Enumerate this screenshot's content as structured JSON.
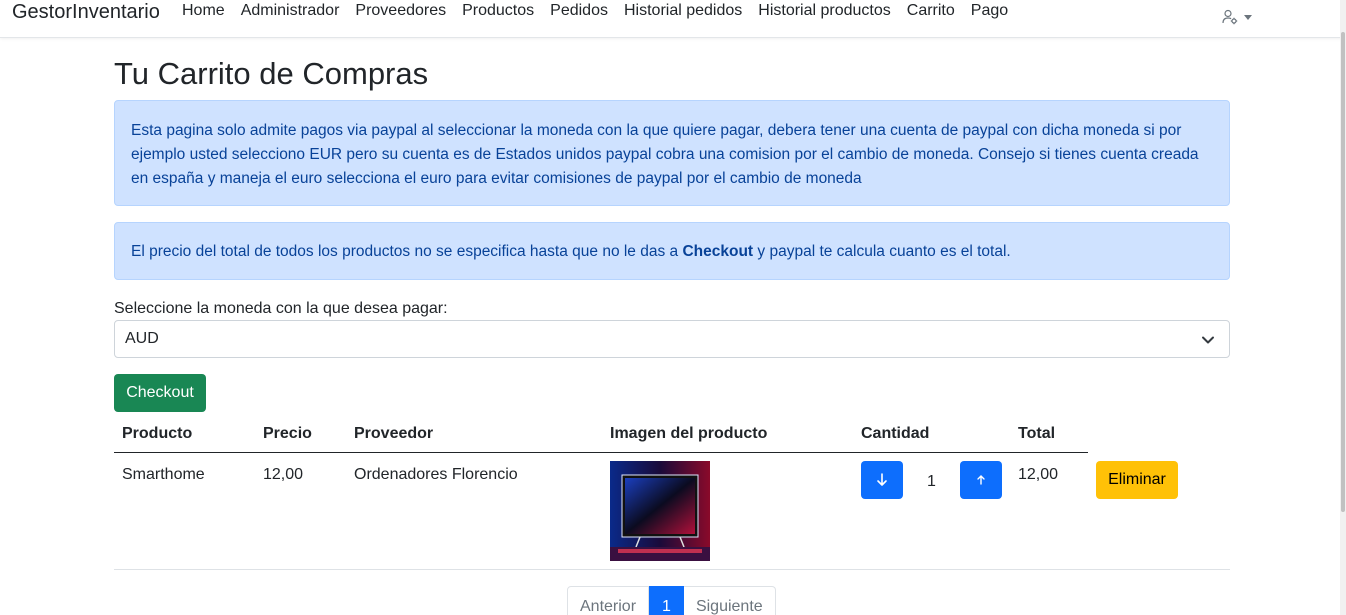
{
  "navbar": {
    "brand": "GestorInventario",
    "links": [
      "Home",
      "Administrador",
      "Proveedores",
      "Productos",
      "Pedidos",
      "Historial pedidos",
      "Historial productos",
      "Carrito",
      "Pago"
    ]
  },
  "page": {
    "title": "Tu Carrito de Compras",
    "alert_info": "Esta pagina solo admite pagos via paypal al seleccionar la moneda con la que quiere pagar, debera tener una cuenta de paypal con dicha moneda si por ejemplo usted selecciono EUR pero su cuenta es de Estados unidos paypal cobra una comision por el cambio de moneda. Consejo si tienes cuenta creada en españa y maneja el euro selecciona el euro para evitar comisiones de paypal por el cambio de moneda",
    "alert_total_before": "El precio del total de todos los productos no se especifica hasta que no le das a ",
    "alert_total_bold": "Checkout",
    "alert_total_after": " y paypal te calcula cuanto es el total."
  },
  "currency": {
    "label": "Seleccione la moneda con la que desea pagar:",
    "selected": "AUD"
  },
  "checkout_label": "Checkout",
  "table": {
    "headers": [
      "Producto",
      "Precio",
      "Proveedor",
      "Imagen del producto",
      "Cantidad",
      "Total"
    ],
    "rows": [
      {
        "product": "Smarthome",
        "price": "12,00",
        "supplier": "Ordenadores Florencio",
        "quantity": "1",
        "total": "12,00",
        "delete_label": "Eliminar"
      }
    ]
  },
  "pagination": {
    "prev": "Anterior",
    "current": "1",
    "next": "Siguiente"
  },
  "colors": {
    "primary": "#0d6efd",
    "success": "#198754",
    "warning": "#ffc107",
    "alert_bg": "#cfe2ff",
    "alert_text": "#084298"
  }
}
